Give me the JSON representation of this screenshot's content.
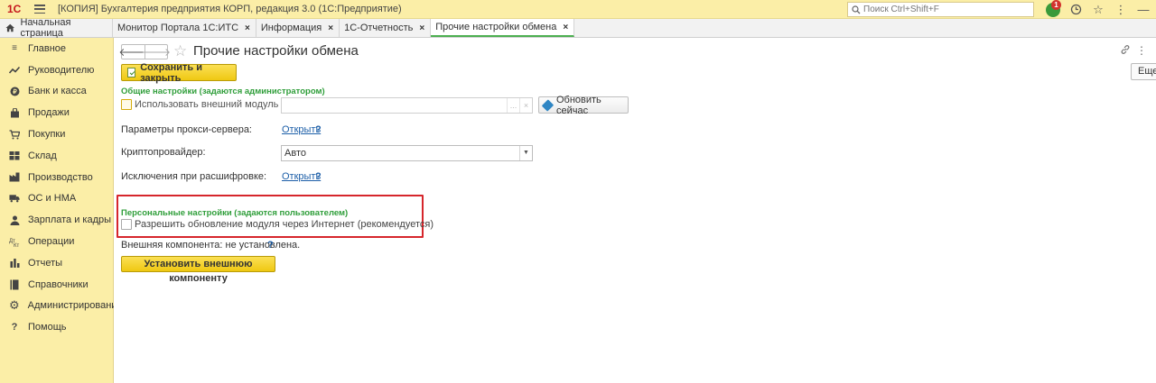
{
  "titlebar": {
    "logo": "1С",
    "title": "[КОПИЯ] Бухгалтерия предприятия КОРП, редакция 3.0  (1С:Предприятие)",
    "search_placeholder": "Поиск Ctrl+Shift+F",
    "notification_count": "1"
  },
  "tabs": {
    "home_label": "Начальная страница",
    "items": [
      {
        "label": "Монитор Портала 1С:ИТС"
      },
      {
        "label": "Информация"
      },
      {
        "label": "1С-Отчетность"
      },
      {
        "label": "Прочие настройки обмена"
      }
    ],
    "close_glyph": "×"
  },
  "sidebar": {
    "items": [
      {
        "label": "Главное",
        "icon": "menu-icon"
      },
      {
        "label": "Руководителю",
        "icon": "trend-icon"
      },
      {
        "label": "Банк и касса",
        "icon": "coin-icon"
      },
      {
        "label": "Продажи",
        "icon": "bag-icon"
      },
      {
        "label": "Покупки",
        "icon": "cart-icon"
      },
      {
        "label": "Склад",
        "icon": "warehouse-icon"
      },
      {
        "label": "Производство",
        "icon": "factory-icon"
      },
      {
        "label": "ОС и НМА",
        "icon": "truck-icon"
      },
      {
        "label": "Зарплата и кадры",
        "icon": "person-icon"
      },
      {
        "label": "Операции",
        "icon": "operations-icon"
      },
      {
        "label": "Отчеты",
        "icon": "bar-chart-icon"
      },
      {
        "label": "Справочники",
        "icon": "book-icon"
      },
      {
        "label": "Администрирование",
        "icon": "gear-icon"
      },
      {
        "label": "Помощь",
        "icon": "help-icon"
      }
    ]
  },
  "main": {
    "title": "Прочие настройки обмена",
    "more_label": "Еще",
    "save_close_label": "Сохранить и закрыть",
    "general_group_title": "Общие настройки (задаются администратором)",
    "use_external_module_label": "Использовать внешний модуль",
    "module_path_value": "",
    "refresh_now_label": "Обновить сейчас",
    "proxy_label": "Параметры прокси-сервера:",
    "proxy_link": "Открыть",
    "crypto_label": "Криптопровайдер:",
    "crypto_value": "Авто",
    "exceptions_label": "Исключения при расшифровке:",
    "exceptions_link": "Открыть",
    "help_glyph": "?",
    "personal_group_title": "Персональные настройки (задаются пользователем)",
    "allow_update_label": "Разрешить обновление модуля через Интернет (рекомендуется)",
    "external_component_status": "Внешняя компонента: не установлена.",
    "install_component_label": "Установить внешнюю компоненту"
  },
  "colors": {
    "accent_yellow": "#fbeea7",
    "group_title_green": "#2f9e3a",
    "highlight_red": "#d6262c",
    "link_blue": "#1d5fa8"
  }
}
